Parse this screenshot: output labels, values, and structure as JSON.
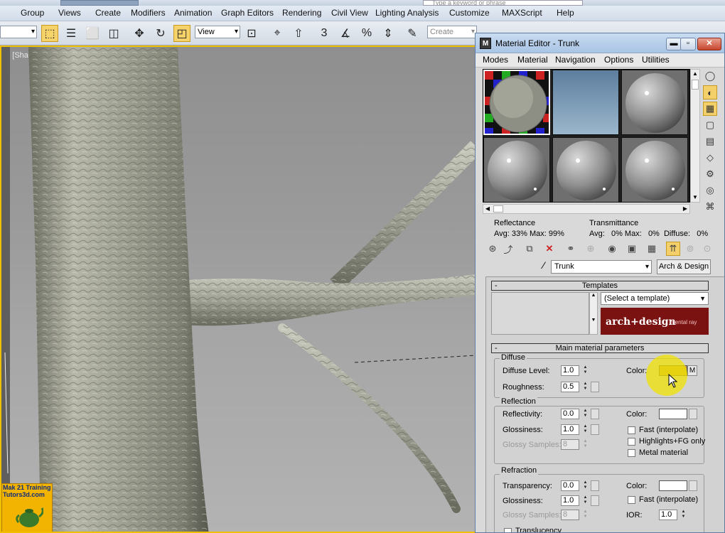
{
  "menubar": {
    "items": [
      "Group",
      "Views",
      "Create",
      "Modifiers",
      "Animation",
      "Graph Editors",
      "Rendering",
      "Civil View",
      "Lighting Analysis",
      "Customize",
      "MAXScript",
      "Help"
    ],
    "search_placeholder": "Type a keyword or phrase"
  },
  "toolbar": {
    "view_dropdown": "View",
    "snap_value": "3",
    "selection_set_placeholder": "Create Selection Se"
  },
  "viewport": {
    "label": "e ] [Shaded ]",
    "logo_line1": "Mak 21 Training",
    "logo_line2": "Tutors3d.com"
  },
  "material_editor": {
    "title": "Material Editor - Trunk",
    "title_icon": "M",
    "menu": [
      "Modes",
      "Material",
      "Navigation",
      "Options",
      "Utilities"
    ],
    "reflectance": {
      "label": "Reflectance",
      "values": "Avg: 33% Max: 99%"
    },
    "transmittance": {
      "label": "Transmittance",
      "values": "Avg:   0% Max:   0%  Diffuse:   0%"
    },
    "material_name": "Trunk",
    "material_type": "Arch & Design",
    "templates": {
      "header": "Templates",
      "dropdown": "(Select a template)",
      "banner_main": "arch+design",
      "banner_sub": "mental ray"
    },
    "main_params": {
      "header": "Main material parameters",
      "diffuse": {
        "group": "Diffuse",
        "level_label": "Diffuse Level:",
        "level": "1.0",
        "roughness_label": "Roughness:",
        "roughness": "0.5",
        "color_label": "Color:",
        "map_btn": "M",
        "color": "#caa24a"
      },
      "reflection": {
        "group": "Reflection",
        "reflectivity_label": "Reflectivity:",
        "reflectivity": "0.0",
        "glossiness_label": "Glossiness:",
        "glossiness": "1.0",
        "samples_label": "Glossy Samples:",
        "samples": "8",
        "color_label": "Color:",
        "fast_label": "Fast (interpolate)",
        "highlights_label": "Highlights+FG only",
        "metal_label": "Metal material"
      },
      "refraction": {
        "group": "Refraction",
        "transparency_label": "Transparency:",
        "transparency": "0.0",
        "glossiness_label": "Glossiness:",
        "glossiness": "1.0",
        "samples_label": "Glossy Samples:",
        "samples": "8",
        "color_label": "Color:",
        "fast_label": "Fast (interpolate)",
        "ior_label": "IOR:",
        "ior": "1.0",
        "translucency_label": "Translucency"
      }
    }
  },
  "colors": {
    "accent_yellow": "#f4d06a",
    "title_blue": "#a9c4e4",
    "banner_red": "#7a1212",
    "viewport_border": "#f0c000"
  }
}
